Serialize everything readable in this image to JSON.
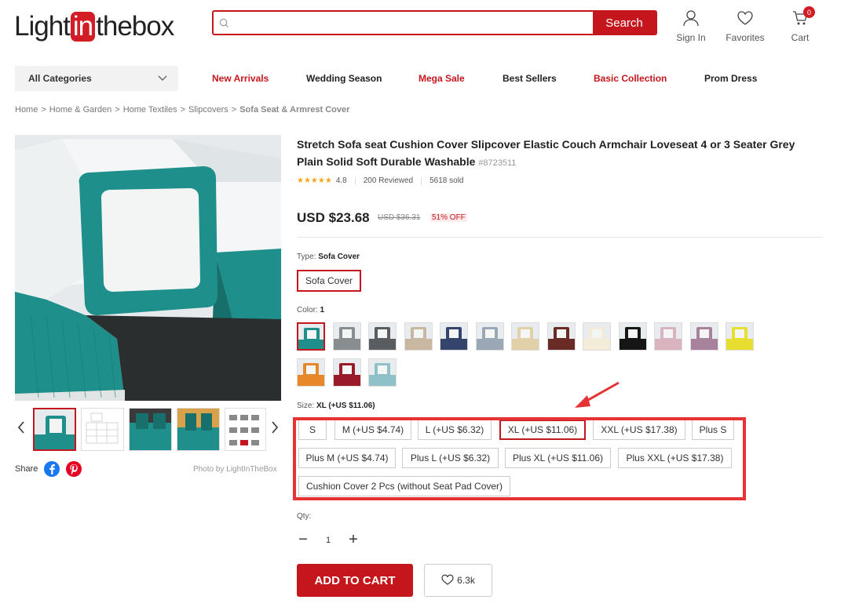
{
  "header": {
    "logo_pre": "Light",
    "logo_mid": "in",
    "logo_post": "thebox",
    "search_placeholder": "",
    "search_button": "Search",
    "sign_in": "Sign In",
    "favorites": "Favorites",
    "cart": "Cart",
    "cart_count": "0"
  },
  "nav": {
    "categories": "All Categories",
    "items": [
      "New Arrivals",
      "Wedding Season",
      "Mega Sale",
      "Best Sellers",
      "Basic Collection",
      "Prom Dress"
    ]
  },
  "breadcrumb": [
    "Home",
    "Home & Garden",
    "Home Textiles",
    "Slipcovers",
    "Sofa Seat & Armrest Cover"
  ],
  "breadcrumb_sep": ">",
  "gallery": {
    "share": "Share",
    "photo_by": "Photo by LightInTheBox"
  },
  "product": {
    "title": "Stretch Sofa seat Cushion Cover Slipcover Elastic Couch Armchair Loveseat 4 or 3 Seater Grey Plain Solid Soft Durable Washable",
    "sku": "#8723511",
    "rating": "4.8",
    "reviews": "200 Reviewed",
    "sold": "5618 sold",
    "price": "USD $23.68",
    "old_price": "USD $36.31",
    "discount": "51% OFF"
  },
  "type": {
    "label": "Type:",
    "value": "Sofa Cover",
    "options": [
      "Sofa Cover"
    ]
  },
  "color": {
    "label": "Color:",
    "value": "1",
    "swatches": [
      "#1e8f8a",
      "#8a8d8f",
      "#5a5d60",
      "#c8b8a2",
      "#34446a",
      "#9aa8b6",
      "#e2d1a8",
      "#6a2a26",
      "#f2ecd8",
      "#161616",
      "#d9b4be",
      "#a8819a",
      "#e8de30",
      "#e8862a",
      "#9a1a2a",
      "#8ec2c8"
    ]
  },
  "size": {
    "label": "Size:",
    "value": "XL (+US $11.06)",
    "options": [
      "S",
      "M (+US $4.74)",
      "L (+US $6.32)",
      "XL (+US $11.06)",
      "XXL (+US $17.38)",
      "Plus S",
      "Plus M (+US $4.74)",
      "Plus L (+US $6.32)",
      "Plus XL (+US $11.06)",
      "Plus XXL (+US $17.38)",
      "Cushion Cover 2 Pcs (without Seat Pad Cover)"
    ]
  },
  "qty": {
    "label": "Qty:",
    "minus": "−",
    "value": "1",
    "plus": "+"
  },
  "actions": {
    "add_to_cart": "ADD TO CART",
    "favorite_count": "6.3k"
  },
  "colors": {
    "brand_red": "#c4161c",
    "highlight_red": "#e63232",
    "star": "#f5a623"
  }
}
